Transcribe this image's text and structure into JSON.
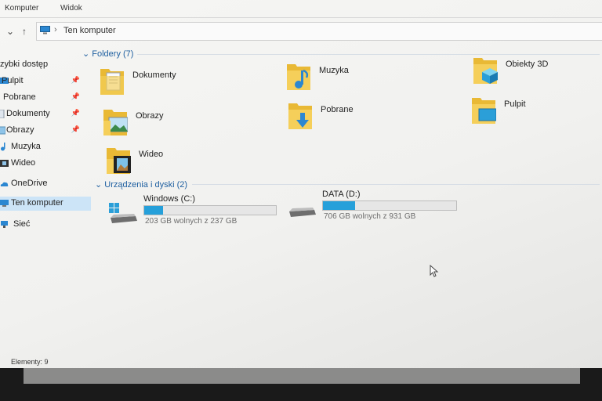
{
  "ribbon": {
    "tabs": [
      "Komputer",
      "Widok"
    ]
  },
  "address": {
    "back": "‹",
    "chevron_down": "⌄",
    "up": "↑",
    "separator": "›",
    "path": "Ten komputer"
  },
  "nav": {
    "quick_access": "zybki dostęp",
    "items": [
      {
        "label": "Pulpit",
        "pin": "📌"
      },
      {
        "label": "Pobrane",
        "pin": "📌"
      },
      {
        "label": "Dokumenty",
        "pin": "📌"
      },
      {
        "label": "Obrazy",
        "pin": "📌"
      },
      {
        "label": "Muzyka"
      },
      {
        "label": "Wideo"
      }
    ],
    "onedrive": "OneDrive",
    "this_pc": "Ten komputer",
    "network": "Sieć"
  },
  "folders": {
    "header": "Foldery (7)",
    "items": [
      {
        "label": "Dokumenty",
        "icon": "documents-folder-icon"
      },
      {
        "label": "Muzyka",
        "icon": "music-folder-icon"
      },
      {
        "label": "Obiekty 3D",
        "icon": "3d-objects-folder-icon"
      },
      {
        "label": "Obrazy",
        "icon": "pictures-folder-icon"
      },
      {
        "label": "Pobrane",
        "icon": "downloads-folder-icon"
      },
      {
        "label": "Pulpit",
        "icon": "desktop-folder-icon"
      },
      {
        "label": "Wideo",
        "icon": "videos-folder-icon"
      }
    ]
  },
  "devices": {
    "header": "Urządzenia i dyski (2)",
    "drives": [
      {
        "name": "Windows (C:)",
        "free": "203 GB wolnych z 237 GB",
        "used_fraction": 0.143
      },
      {
        "name": "DATA (D:)",
        "free": "706 GB wolnych z 931 GB",
        "used_fraction": 0.242
      }
    ]
  },
  "status": {
    "items": "Elementy: 9"
  },
  "colors": {
    "accent": "#26a0da",
    "header_blue": "#1e5fa0",
    "folder_yellow": "#f0c341",
    "selection": "#cce4f7"
  }
}
